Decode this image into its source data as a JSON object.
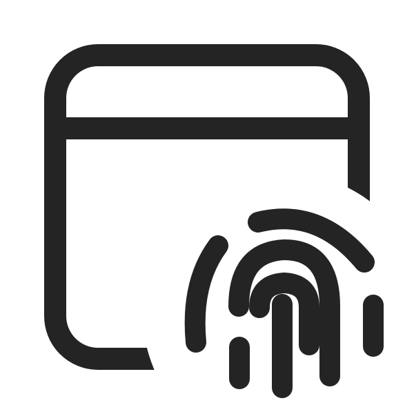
{
  "icon": {
    "name": "browser-window-fingerprint-icon",
    "ink_color": "#242424",
    "background_color": "#ffffff"
  }
}
